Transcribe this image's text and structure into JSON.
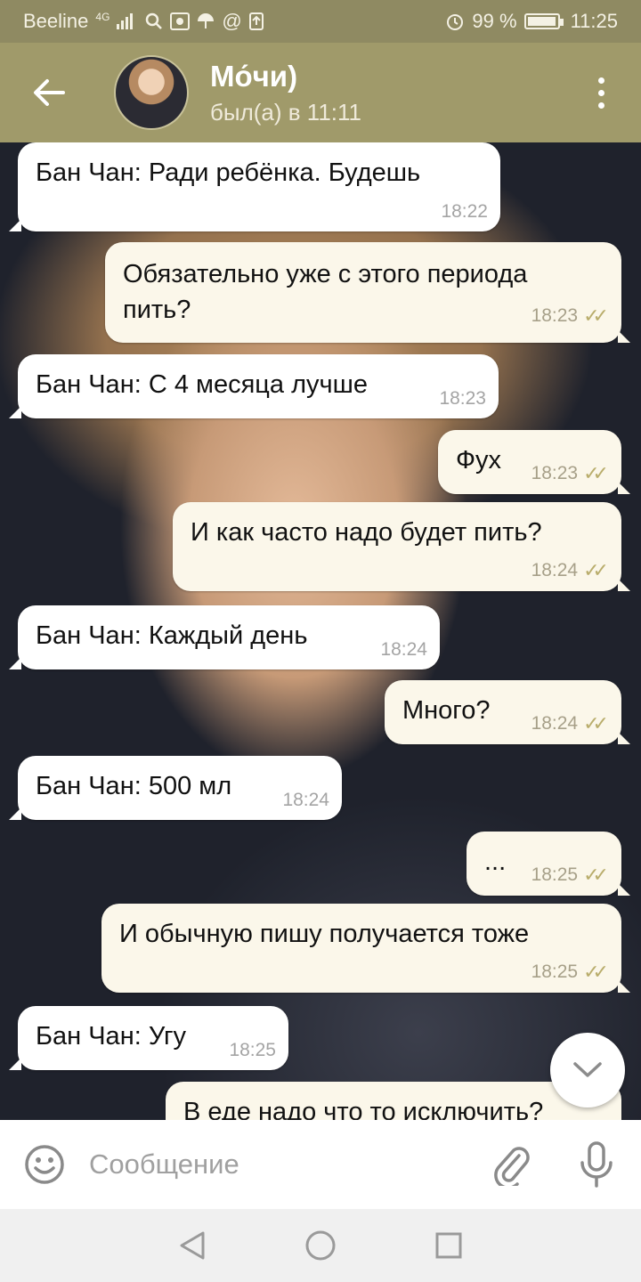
{
  "status_bar": {
    "carrier": "Beeline",
    "network": "4G",
    "battery": "99 %",
    "battery_level": 0.99,
    "time": "11:25"
  },
  "header": {
    "title": "Мо́чи)",
    "subtitle": "был(а) в 11:11"
  },
  "messages": [
    {
      "direction": "in",
      "text": "Бан Чан: Ради ребёнка. Будешь",
      "time": "18:22",
      "read": false
    },
    {
      "direction": "out",
      "text": "Обязательно уже с этого периода пить?",
      "time": "18:23",
      "read": true
    },
    {
      "direction": "in",
      "text": "Бан Чан: С 4 месяца лучше",
      "time": "18:23",
      "read": false
    },
    {
      "direction": "out",
      "text": "Фух",
      "time": "18:23",
      "read": true
    },
    {
      "direction": "out",
      "text": "И как часто надо будет пить?",
      "time": "18:24",
      "read": true
    },
    {
      "direction": "in",
      "text": "Бан Чан: Каждый день",
      "time": "18:24",
      "read": false
    },
    {
      "direction": "out",
      "text": "Много?",
      "time": "18:24",
      "read": true
    },
    {
      "direction": "in",
      "text": "Бан Чан: 500 мл",
      "time": "18:24",
      "read": false
    },
    {
      "direction": "out",
      "text": "...",
      "time": "18:25",
      "read": true
    },
    {
      "direction": "out",
      "text": "И обычную пишу получается тоже",
      "time": "18:25",
      "read": true
    },
    {
      "direction": "in",
      "text": "Бан Чан: Угу",
      "time": "18:25",
      "read": false
    },
    {
      "direction": "out",
      "text": "В еде надо что то исключить?",
      "time": "",
      "read": false
    }
  ],
  "composer": {
    "placeholder": "Сообщение"
  },
  "icons": {
    "back": "arrow-left-icon",
    "menu": "more-vertical-icon",
    "emoji": "smiley-icon",
    "attach": "paperclip-icon",
    "mic": "microphone-icon",
    "scroll": "chevron-down-icon",
    "nav_back": "triangle-back-icon",
    "nav_home": "circle-home-icon",
    "nav_recent": "square-recent-icon"
  },
  "colors": {
    "header": "#a09a6a",
    "status_bar": "#8f8a62",
    "outgoing_bubble": "#fbf7ea",
    "incoming_bubble": "#ffffff",
    "read_check": "#b9ad6c"
  }
}
